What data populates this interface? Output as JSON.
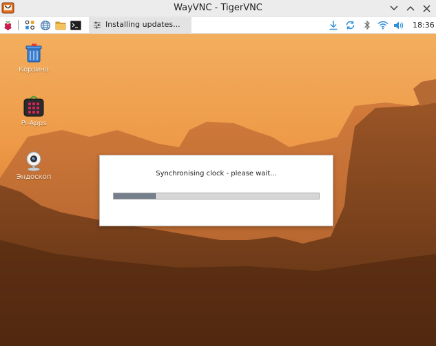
{
  "window": {
    "title": "WayVNC - TigerVNC"
  },
  "taskbar": {
    "launchers": [
      {
        "name": "raspberry-menu",
        "icon": "raspberry-icon"
      },
      {
        "name": "app-grid",
        "icon": "app-grid-icon"
      },
      {
        "name": "web-browser",
        "icon": "globe-icon"
      },
      {
        "name": "file-manager",
        "icon": "folder-icon"
      },
      {
        "name": "terminal",
        "icon": "terminal-icon"
      }
    ],
    "task": {
      "label": "Installing updates...",
      "icon": "settings-sliders-icon"
    },
    "tray": {
      "icons": [
        "download-icon",
        "sync-icon",
        "bluetooth-icon",
        "wifi-icon",
        "volume-icon"
      ],
      "clock": "18:36"
    }
  },
  "desktop": {
    "icons": [
      {
        "label": "Корзина",
        "icon": "trash-icon"
      },
      {
        "label": "Pi-Apps",
        "icon": "pi-apps-icon"
      },
      {
        "label": "Эндоскоп",
        "icon": "webcam-icon"
      }
    ]
  },
  "dialog": {
    "message": "Synchronising clock - please wait...",
    "progress": 0.2
  },
  "colors": {
    "accent": "#2f8fd8",
    "progress_fill": "#75808c",
    "sky_top": "#f0a95a",
    "sky_bottom": "#a25424"
  }
}
